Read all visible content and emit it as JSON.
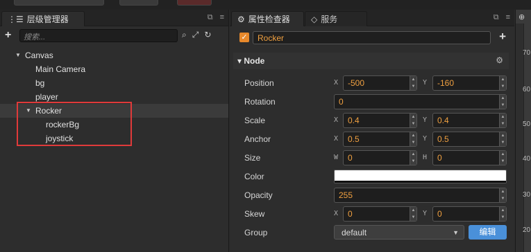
{
  "hierarchy": {
    "tab_label": "层级管理器",
    "search_placeholder": "搜索...",
    "tree": [
      {
        "label": "Canvas",
        "expanded": true
      },
      {
        "label": "Main Camera"
      },
      {
        "label": "bg"
      },
      {
        "label": "player"
      },
      {
        "label": "Rocker",
        "expanded": true,
        "selected": true
      },
      {
        "label": "rockerBg"
      },
      {
        "label": "joystick"
      }
    ]
  },
  "inspector": {
    "tab_label": "属性检查器",
    "services_tab_label": "服务",
    "node_name": "Rocker",
    "active": true,
    "section_label": "Node",
    "properties": {
      "position": {
        "label": "Position",
        "x_axis": "X",
        "y_axis": "Y",
        "x": "-500",
        "y": "-160"
      },
      "rotation": {
        "label": "Rotation",
        "value": "0"
      },
      "scale": {
        "label": "Scale",
        "x_axis": "X",
        "y_axis": "Y",
        "x": "0.4",
        "y": "0.4"
      },
      "anchor": {
        "label": "Anchor",
        "x_axis": "X",
        "y_axis": "Y",
        "x": "0.5",
        "y": "0.5"
      },
      "size": {
        "label": "Size",
        "w_axis": "W",
        "h_axis": "H",
        "w": "0",
        "h": "0"
      },
      "color": {
        "label": "Color",
        "value": "#ffffff"
      },
      "opacity": {
        "label": "Opacity",
        "value": "255"
      },
      "skew": {
        "label": "Skew",
        "x_axis": "X",
        "y_axis": "Y",
        "x": "0",
        "y": "0"
      },
      "group": {
        "label": "Group",
        "value": "default",
        "edit_label": "编辑"
      }
    }
  },
  "scene_ruler": {
    "ticks": [
      "70",
      "60",
      "50",
      "40",
      "30",
      "20"
    ]
  },
  "colors": {
    "accent_orange": "#f0a040",
    "checkbox_orange": "#e8892b",
    "edit_button_blue": "#4a90d9",
    "highlight_red": "#e03a3a"
  },
  "icons": [
    "hierarchy-icon",
    "plus-icon",
    "search-icon",
    "expand-icon",
    "refresh-icon",
    "settings-icon",
    "gear-icon",
    "cloud-icon",
    "inspector-icon",
    "zoom-icon"
  ]
}
